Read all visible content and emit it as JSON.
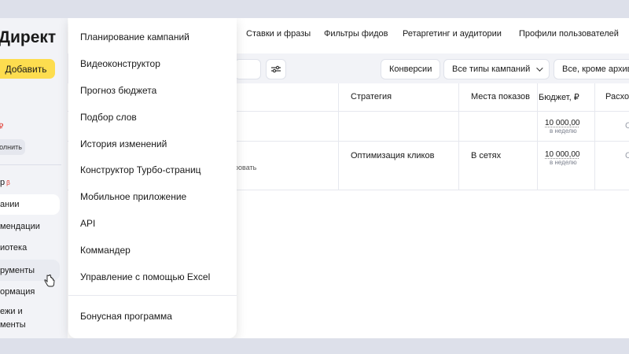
{
  "sidebar": {
    "logo": "Директ",
    "add_button": "Добавить",
    "promo_mark": "₽",
    "fill_button": "олнить",
    "nav": [
      {
        "label": "р",
        "beta": "β"
      },
      {
        "label": "ании"
      },
      {
        "label": "мендации"
      },
      {
        "label": "иотека"
      },
      {
        "label": "рументы"
      },
      {
        "label": "ормация"
      },
      {
        "label": "ежи и"
      },
      {
        "label": "менты"
      }
    ]
  },
  "tabs": [
    "Ставки и фразы",
    "Фильтры фидов",
    "Ретаргетинг и аудитории",
    "Профили пользователей"
  ],
  "toolbar": {
    "chips": [
      "Конверсии",
      "Все типы кампаний",
      "Все, кроме архив"
    ]
  },
  "table": {
    "headers": [
      "Стратегия",
      "Места показов",
      "Бюджет, ₽",
      "Расхо"
    ],
    "rows": [
      {
        "strategy": "",
        "places": "",
        "budget": "10 000,00",
        "budget_period": "в неделю",
        "spend": "С",
        "note": ""
      },
      {
        "strategy": "Оптимизация кликов",
        "places": "В сетях",
        "budget": "10 000,00",
        "budget_period": "в неделю",
        "spend": "С",
        "note": "ровать"
      }
    ]
  },
  "menu": {
    "items": [
      "Планирование кампаний",
      "Видеоконструктор",
      "Прогноз бюджета",
      "Подбор слов",
      "История изменений",
      "Конструктор Турбо-страниц",
      "Мобильное приложение",
      "API",
      "Коммандер",
      "Управление с помощью Excel"
    ],
    "bonus": "Бонусная программа"
  },
  "colors": {
    "accent_yellow": "#fddd4f",
    "beta_red": "#e0342a",
    "page_bg": "#dde0ea"
  },
  "icons": [
    "filter-settings-icon",
    "chevron-down-icon",
    "hand-cursor-icon"
  ]
}
